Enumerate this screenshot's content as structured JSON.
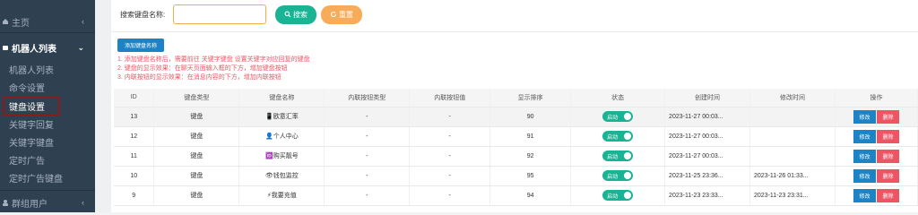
{
  "sidebar": {
    "home_label": "主页",
    "group_label": "机器人列表",
    "items": [
      {
        "label": "机器人列表"
      },
      {
        "label": "命令设置"
      },
      {
        "label": "键盘设置"
      },
      {
        "label": "关键字回复"
      },
      {
        "label": "关键字键盘"
      },
      {
        "label": "定时广告"
      },
      {
        "label": "定时广告键盘"
      }
    ],
    "bottom_label": "群组用户"
  },
  "search": {
    "label": "搜索键盘名称:",
    "value": "",
    "search_button": "搜索",
    "reset_button": "重置"
  },
  "add_button": "添加键盘名称",
  "notes": [
    "1. 添加键盘名称后，需要前往 关键字键盘 设置关键字对应回复的键盘",
    "2. 键盘的显示效果：在聊天页面输入框的下方，增加键盘按钮",
    "3. 内联按钮的显示效果：在消息内容的下方，增加内联按钮"
  ],
  "table": {
    "headers": [
      "ID",
      "键盘类型",
      "键盘名称",
      "内联按钮类型",
      "内联按钮值",
      "显示排序",
      "状态",
      "创建时间",
      "修改时间",
      "操作"
    ],
    "rows": [
      {
        "id": "13",
        "type": "键盘",
        "name": "📱欧意汇率",
        "inline_type": "-",
        "inline_value": "-",
        "sort": "90",
        "status": "启动",
        "created": "2023-11-27 00:03...",
        "modified": "",
        "edit": "修改",
        "delete": "删除"
      },
      {
        "id": "12",
        "type": "键盘",
        "name": "👤个人中心",
        "inline_type": "-",
        "inline_value": "-",
        "sort": "91",
        "status": "启动",
        "created": "2023-11-27 00:03...",
        "modified": "",
        "edit": "修改",
        "delete": "删除"
      },
      {
        "id": "11",
        "type": "键盘",
        "name": "🆔购买靓号",
        "inline_type": "-",
        "inline_value": "-",
        "sort": "92",
        "status": "启动",
        "created": "2023-11-27 00:03...",
        "modified": "",
        "edit": "修改",
        "delete": "删除"
      },
      {
        "id": "10",
        "type": "键盘",
        "name": "👁钱包监控",
        "inline_type": "-",
        "inline_value": "-",
        "sort": "95",
        "status": "启动",
        "created": "2023-11-25 23:36...",
        "modified": "2023-11-26 01:33...",
        "edit": "修改",
        "delete": "删除"
      },
      {
        "id": "9",
        "type": "键盘",
        "name": "⚡我要充值",
        "inline_type": "-",
        "inline_value": "-",
        "sort": "94",
        "status": "启动",
        "created": "2023-11-23 23:33...",
        "modified": "2023-11-23 23:31...",
        "edit": "修改",
        "delete": "删除"
      }
    ]
  },
  "colors": {
    "sidebar_bg": "#2f4050",
    "primary": "#1ab394",
    "warning": "#f8ac59",
    "blue": "#1c84c6",
    "danger": "#ed5565"
  }
}
